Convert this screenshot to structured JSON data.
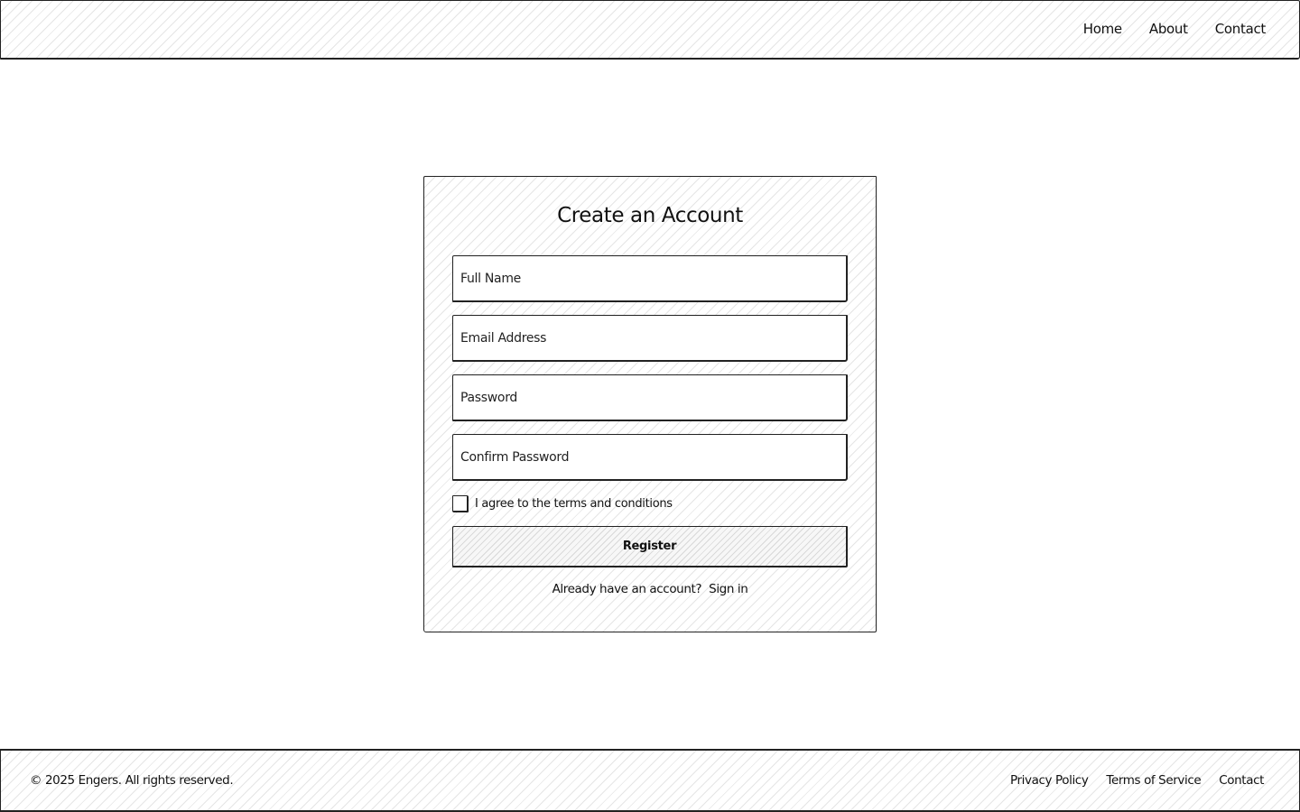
{
  "header": {
    "nav": [
      {
        "label": "Home"
      },
      {
        "label": "About"
      },
      {
        "label": "Contact"
      }
    ]
  },
  "form": {
    "title": "Create an Account",
    "fields": {
      "full_name": {
        "placeholder": "Full Name",
        "value": ""
      },
      "email": {
        "placeholder": "Email Address",
        "value": ""
      },
      "password": {
        "placeholder": "Password",
        "value": ""
      },
      "confirm_password": {
        "placeholder": "Confirm Password",
        "value": ""
      }
    },
    "agree_label": "I agree to the terms and conditions",
    "agree_checked": false,
    "register_label": "Register",
    "signin_prompt": "Already have an account?",
    "signin_link": "Sign in"
  },
  "footer": {
    "copyright": "© 2025 Engers. All rights reserved.",
    "links": [
      {
        "label": "Privacy Policy"
      },
      {
        "label": "Terms of Service"
      },
      {
        "label": "Contact"
      }
    ]
  }
}
